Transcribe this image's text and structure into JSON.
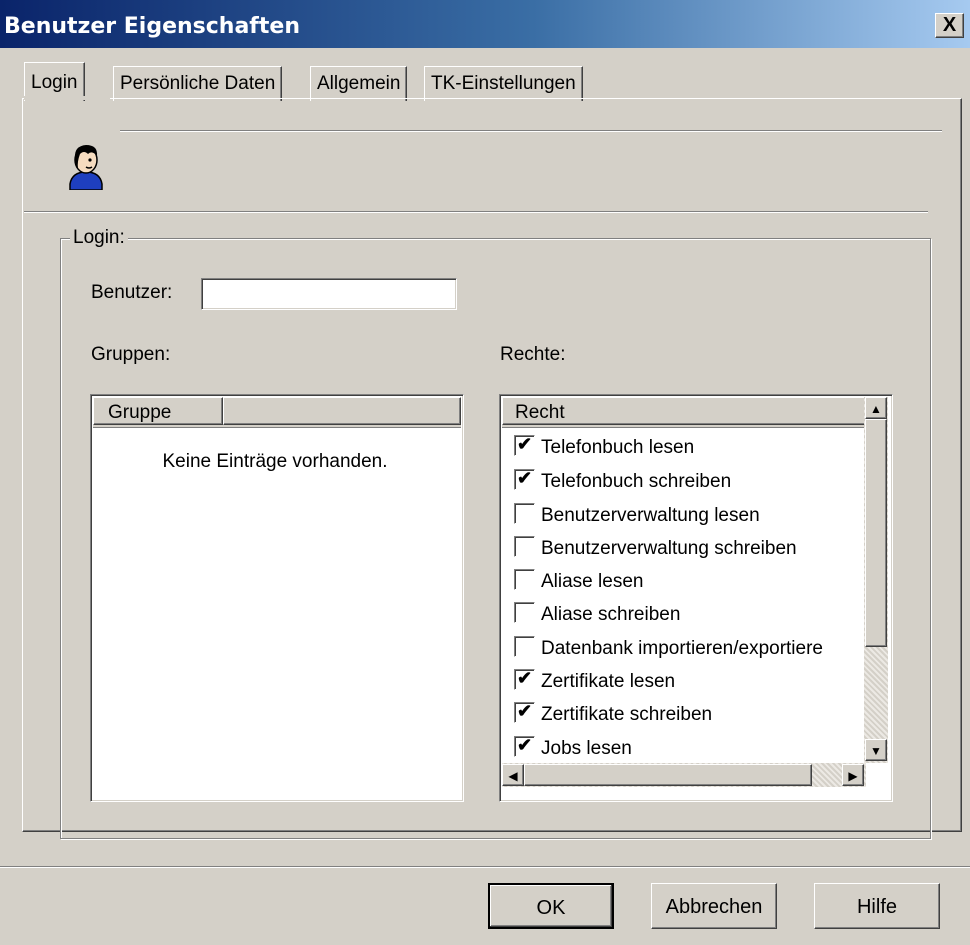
{
  "window": {
    "title": "Benutzer Eigenschaften",
    "close_glyph": "X"
  },
  "tabs": [
    {
      "label": "Login",
      "active": true
    },
    {
      "label": "Persönliche Daten",
      "active": false
    },
    {
      "label": "Allgemein",
      "active": false
    },
    {
      "label": "TK-Einstellungen",
      "active": false
    }
  ],
  "user_icon": "user-avatar-icon",
  "login_group": {
    "label": "Login:",
    "benutzer_label": "Benutzer:",
    "benutzer_value": "",
    "gruppen_label": "Gruppen:",
    "rechte_label": "Rechte:"
  },
  "groups_list": {
    "columns": [
      "Gruppe",
      ""
    ],
    "empty_text": "Keine Einträge vorhanden."
  },
  "rights_list": {
    "column": "Recht",
    "items": [
      {
        "label": "Telefonbuch lesen",
        "checked": true
      },
      {
        "label": "Telefonbuch schreiben",
        "checked": true
      },
      {
        "label": "Benutzerverwaltung lesen",
        "checked": false
      },
      {
        "label": "Benutzerverwaltung schreiben",
        "checked": false
      },
      {
        "label": "Aliase lesen",
        "checked": false
      },
      {
        "label": "Aliase schreiben",
        "checked": false
      },
      {
        "label": "Datenbank importieren/exportiere",
        "checked": false
      },
      {
        "label": "Zertifikate lesen",
        "checked": true
      },
      {
        "label": "Zertifikate schreiben",
        "checked": true
      },
      {
        "label": "Jobs lesen",
        "checked": true
      }
    ]
  },
  "buttons": {
    "ok": "OK",
    "cancel": "Abbrechen",
    "help": "Hilfe"
  }
}
